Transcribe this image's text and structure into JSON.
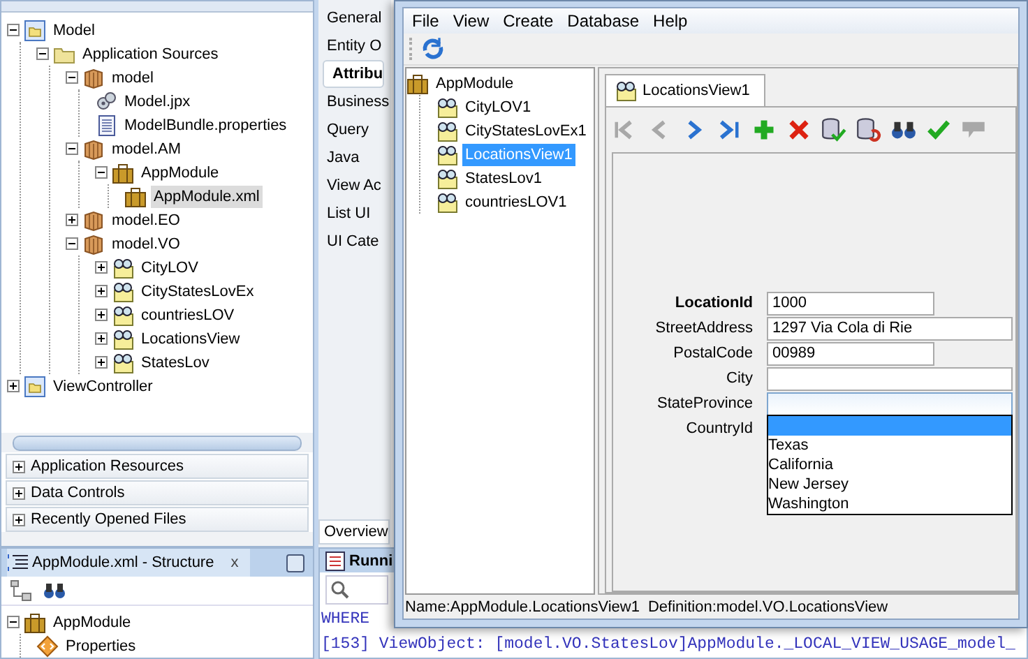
{
  "projects": {
    "tree": [
      {
        "label": "Model",
        "kind": "project",
        "expanded": true,
        "selected": false,
        "children": [
          {
            "label": "Application Sources",
            "kind": "folder",
            "expanded": true,
            "selected": false,
            "children": [
              {
                "label": "model",
                "kind": "package",
                "expanded": true,
                "selected": false,
                "children": [
                  {
                    "label": "Model.jpx",
                    "kind": "jpx",
                    "selected": false
                  },
                  {
                    "label": "ModelBundle.properties",
                    "kind": "properties",
                    "selected": false
                  }
                ]
              },
              {
                "label": "model.AM",
                "kind": "package",
                "expanded": true,
                "selected": false,
                "children": [
                  {
                    "label": "AppModule",
                    "kind": "appmodule",
                    "expanded": true,
                    "selected": false,
                    "children": [
                      {
                        "label": "AppModule.xml",
                        "kind": "appmodule",
                        "selected": true
                      }
                    ]
                  }
                ]
              },
              {
                "label": "model.EO",
                "kind": "package",
                "expanded": false,
                "selected": false
              },
              {
                "label": "model.VO",
                "kind": "package",
                "expanded": true,
                "selected": false,
                "children": [
                  {
                    "label": "CityLOV",
                    "kind": "view",
                    "expanded": false,
                    "selected": false
                  },
                  {
                    "label": "CityStatesLovEx",
                    "kind": "view",
                    "expanded": false,
                    "selected": false
                  },
                  {
                    "label": "countriesLOV",
                    "kind": "view",
                    "expanded": false,
                    "selected": false
                  },
                  {
                    "label": "LocationsView",
                    "kind": "view",
                    "expanded": false,
                    "selected": false
                  },
                  {
                    "label": "StatesLov",
                    "kind": "view",
                    "expanded": false,
                    "selected": false
                  }
                ]
              }
            ]
          }
        ]
      },
      {
        "label": "ViewController",
        "kind": "project",
        "expanded": false,
        "selected": false
      }
    ],
    "sections": [
      {
        "label": "Application Resources",
        "expanded": false
      },
      {
        "label": "Data Controls",
        "expanded": false
      },
      {
        "label": "Recently Opened Files",
        "expanded": false
      }
    ]
  },
  "editor": {
    "nav": [
      {
        "label": "General",
        "selected": false
      },
      {
        "label": "Entity O",
        "selected": false
      },
      {
        "label": "Attribu",
        "selected": true
      },
      {
        "label": "Business",
        "selected": false
      },
      {
        "label": "Query",
        "selected": false
      },
      {
        "label": "Java",
        "selected": false
      },
      {
        "label": "View Ac",
        "selected": false
      },
      {
        "label": "List UI",
        "selected": false
      },
      {
        "label": "UI Cate",
        "selected": false
      }
    ],
    "bottom_tab": "Overview"
  },
  "structure": {
    "title": "AppModule.xml - Structure",
    "close": "x",
    "tree": [
      {
        "label": "AppModule",
        "kind": "appmodule",
        "expanded": true,
        "selected": false,
        "children": [
          {
            "label": "Properties",
            "kind": "tag",
            "selected": false
          }
        ]
      }
    ]
  },
  "log": {
    "title": "Runni",
    "lines": [
      "WHERE",
      "[153] ViewObject: [model.VO.StatesLov]AppModule._LOCAL_VIEW_USAGE_model_"
    ]
  },
  "tester": {
    "menu": [
      "File",
      "View",
      "Create",
      "Database",
      "Help"
    ],
    "tree": [
      {
        "label": "AppModule",
        "kind": "appmodule",
        "selected": false,
        "children": [
          {
            "label": "CityLOV1",
            "kind": "view",
            "selected": false
          },
          {
            "label": "CityStatesLovEx1",
            "kind": "view",
            "selected": false
          },
          {
            "label": "LocationsView1",
            "kind": "view",
            "selected": true
          },
          {
            "label": "StatesLov1",
            "kind": "view",
            "selected": false
          },
          {
            "label": "countriesLOV1",
            "kind": "view",
            "selected": false
          }
        ]
      }
    ],
    "tab": "LocationsView1",
    "toolbar": [
      {
        "kind": "first",
        "disabled": true
      },
      {
        "kind": "prev",
        "disabled": true
      },
      {
        "kind": "next",
        "disabled": false
      },
      {
        "kind": "last",
        "disabled": false
      },
      {
        "kind": "add",
        "disabled": false
      },
      {
        "kind": "delete",
        "disabled": false
      },
      {
        "kind": "commit",
        "disabled": false
      },
      {
        "kind": "rollback",
        "disabled": false
      },
      {
        "kind": "find",
        "disabled": false
      },
      {
        "kind": "validate",
        "disabled": false
      },
      {
        "kind": "edit",
        "disabled": true
      }
    ],
    "fields": [
      {
        "label": "LocationId",
        "kind": "short",
        "key": true,
        "value": "1000"
      },
      {
        "label": "StreetAddress",
        "kind": "text",
        "key": false,
        "value": "1297 Via Cola di Rie"
      },
      {
        "label": "PostalCode",
        "kind": "short",
        "key": false,
        "value": "00989"
      },
      {
        "label": "City",
        "kind": "text",
        "key": false
      },
      {
        "label": "StateProvince",
        "kind": "combo",
        "key": false,
        "expanded": true,
        "options": [
          "Texas",
          "California",
          "New Jersey",
          "Washington"
        ]
      },
      {
        "label": "CountryId",
        "kind": "none",
        "key": false
      }
    ],
    "status": [
      "Name:AppModule.LocationsView1",
      "Definition:model.VO.LocationsView"
    ]
  }
}
